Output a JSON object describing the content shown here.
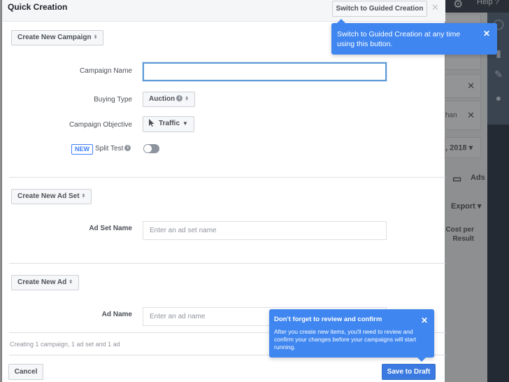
{
  "background": {
    "help_label": "Help",
    "card_partial_text": "han",
    "date_partial": ", 2018",
    "tab_ads_label": "Ads",
    "export_label": "Export",
    "column_header": "Cost per Result"
  },
  "modal": {
    "title": "Quick Creation",
    "guided_button_label": "Switch to Guided Creation",
    "campaign": {
      "section_button_label": "Create New Campaign",
      "name_label": "Campaign Name",
      "name_value": "",
      "buying_type_label": "Buying Type",
      "buying_type_value": "Auction",
      "objective_label": "Campaign Objective",
      "objective_value": "Traffic",
      "new_badge": "NEW",
      "split_test_label": "Split Test",
      "split_test_enabled": false
    },
    "ad_set": {
      "section_button_label": "Create New Ad Set",
      "name_label": "Ad Set Name",
      "name_placeholder": "Enter an ad set name",
      "name_value": ""
    },
    "ad": {
      "section_button_label": "Create New Ad",
      "name_label": "Ad Name",
      "name_placeholder": "Enter an ad name",
      "name_value": ""
    },
    "footer": {
      "summary": "Creating 1 campaign, 1 ad set and 1 ad",
      "cancel_label": "Cancel",
      "save_label": "Save to Draft"
    }
  },
  "tooltips": {
    "guided": {
      "text": "Switch to Guided Creation at any time using this button."
    },
    "review": {
      "title": "Don't forget to review and confirm",
      "body": "After you create new items, you'll need to review and confirm your changes before your campaigns will start running."
    }
  },
  "colors": {
    "accent": "#3f86f0",
    "primary_button": "#3b7ae0",
    "new_badge": "#4080ff"
  }
}
